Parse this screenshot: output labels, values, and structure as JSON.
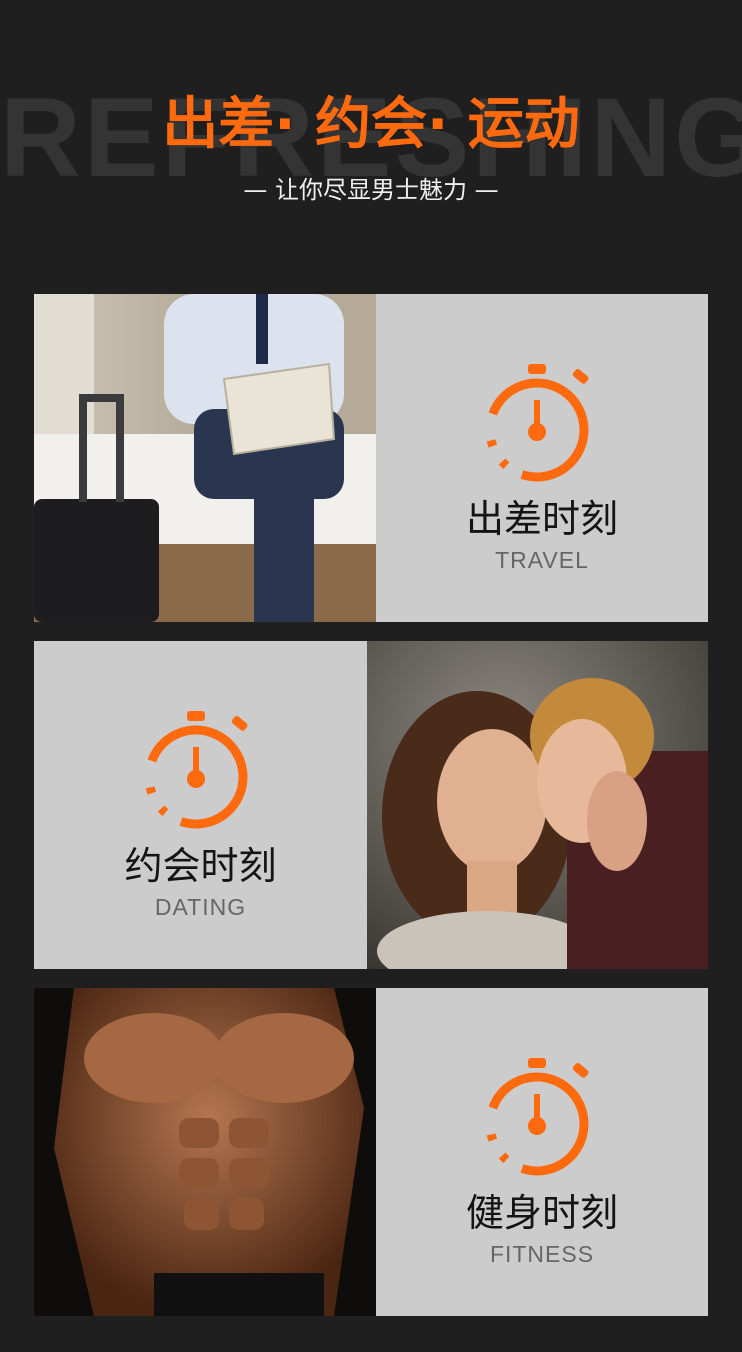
{
  "header": {
    "bg_word": "REFRESHING",
    "title": "出差· 约会· 运动",
    "subtitle": "— 让你尽显男士魅力 —"
  },
  "colors": {
    "accent": "#ff6a0f",
    "panel": "#cccccc",
    "background": "#1f1f1f"
  },
  "cards": [
    {
      "title": "出差时刻",
      "subtitle": "TRAVEL",
      "icon": "stopwatch-icon",
      "photo": "businessman-on-hotel-bed-photo"
    },
    {
      "title": "约会时刻",
      "subtitle": "DATING",
      "icon": "stopwatch-icon",
      "photo": "couple-kissing-photo"
    },
    {
      "title": "健身时刻",
      "subtitle": "FITNESS",
      "icon": "stopwatch-icon",
      "photo": "muscular-torso-photo"
    }
  ]
}
